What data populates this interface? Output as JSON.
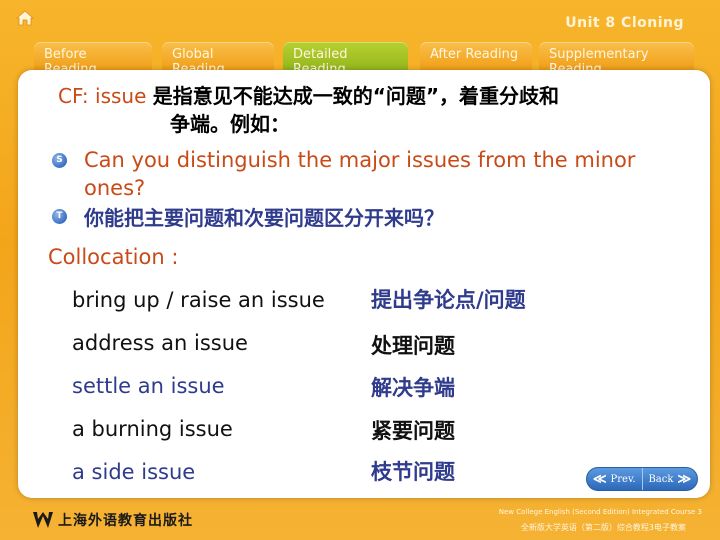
{
  "header": {
    "unit_title": "Unit 8 Cloning",
    "icons": {
      "home": "home-icon"
    }
  },
  "tabs": [
    {
      "label": "Before\nReading",
      "state": "inactive"
    },
    {
      "label": "Global\nReading",
      "state": "inactive"
    },
    {
      "label": "Detailed\nReading",
      "state": "active"
    },
    {
      "label": "After Reading",
      "state": "inactive"
    },
    {
      "label": "Supplementary\nReading",
      "state": "inactive"
    }
  ],
  "content": {
    "cf_term": "CF: issue ",
    "cf_definition_1": "是指意见不能达成一致的“问题”，着重分歧和",
    "cf_definition_2": "争端。例如：",
    "sentence_s_marker": "S",
    "sentence_s": "Can you distinguish the major issues from the minor ones?",
    "sentence_t_marker": "T",
    "sentence_t": "你能把主要问题和次要问题区分开来吗？",
    "collocation_label": "Collocation :",
    "collocations": [
      {
        "en": "bring up / raise an issue",
        "zh": "提出争论点/问题",
        "style": "en-black-zh-blue"
      },
      {
        "en": "address an issue",
        "zh": "处理问题",
        "style": "black"
      },
      {
        "en": "settle an issue",
        "zh": "解决争端",
        "style": "blue"
      },
      {
        "en": "a burning issue",
        "zh": "紧要问题",
        "style": "black"
      },
      {
        "en": "a side issue",
        "zh": "枝节问题",
        "style": "blue"
      }
    ]
  },
  "nav": {
    "prev_label": "Prev.",
    "back_label": "Back"
  },
  "footer": {
    "publisher": "上海外语教育出版社",
    "course_en": "New College English (Second Edition) Integrated Course 3",
    "course_zh": "全新版大学英语（第二版）综合教程3电子教案"
  },
  "colors": {
    "accent_orange": "#c94a16",
    "accent_blue": "#2f3b8c",
    "active_tab": "#9fbf22",
    "background": "#f5aa22"
  }
}
